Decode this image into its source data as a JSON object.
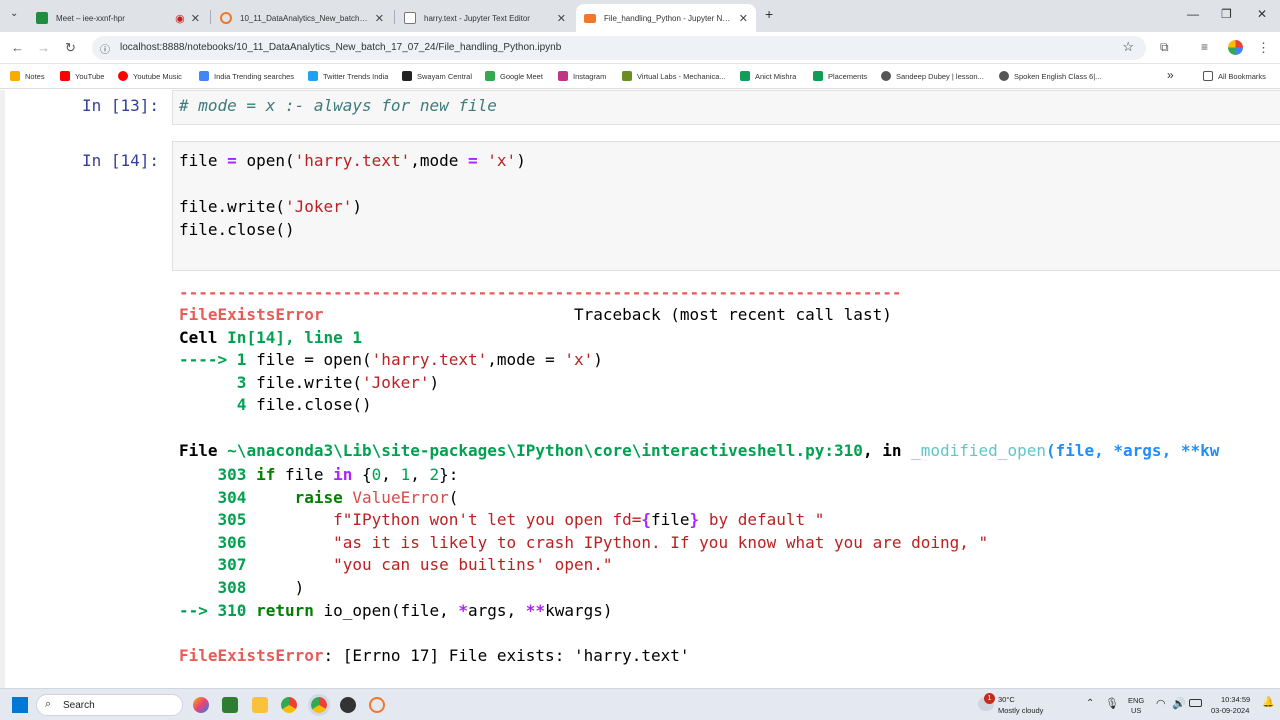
{
  "tabs": [
    {
      "title": "Meet – iee-xxnf-hpr",
      "fav": "#1a73e8"
    },
    {
      "title": "10_11_DataAnalytics_New_batch_17_0",
      "fav": "#f37726"
    },
    {
      "title": "harry.text - Jupyter Text Editor",
      "fav": "#f37726"
    },
    {
      "title": "File_handling_Python - Jupyter Notebo",
      "fav": "#f37726"
    }
  ],
  "url": "localhost:8888/notebooks/10_11_DataAnalytics_New_batch_17_07_24/File_handling_Python.ipynb",
  "bookmarks": [
    "Notes",
    "YouTube",
    "Youtube Music",
    "India Trending searches",
    "Twitter Trends India",
    "Swayam Central",
    "Google Meet",
    "Instagram",
    "Virtual Labs - Mechanica...",
    "Anict Mishra",
    "Placements",
    "Sandeep Dubey | lesson...",
    "Spoken English Class 6|..."
  ],
  "all_bookmarks": "All Bookmarks",
  "cells": {
    "c13": {
      "prompt": "In [13]:",
      "comment": "# mode = x :- always for new file"
    },
    "c14": {
      "prompt": "In [14]:",
      "l1": {
        "a": "file ",
        "op": "=",
        "b": " open(",
        "s1": "'harry.text'",
        "c": ",mode ",
        "op2": "=",
        "d": " ",
        "s2": "'x'",
        "e": ")"
      },
      "l2": {
        "a": "file.write(",
        "s": "'Joker'",
        "b": ")"
      },
      "l3": "file.close()"
    }
  },
  "traceback": {
    "dashes": "---------------------------------------------------------------------------",
    "err_name": "FileExistsError",
    "tb_head": "                          Traceback (most recent call last)",
    "cell_pre": "Cell ",
    "cell_ref": "In[14], line 1",
    "arrow1": "----> 1 ",
    "l1a": "file ",
    "l1op": "=",
    "l1b": " open(",
    "l1s": "'harry.text'",
    "l1c": ",mode ",
    "l1op2": "=",
    "l1d": " ",
    "l1s2": "'x'",
    "l1e": ")",
    "n3": "      3 ",
    "l3a": "file.write(",
    "l3s": "'Joker'",
    "l3b": ")",
    "n4": "      4 ",
    "l4": "file.close()",
    "file_pre": "File ",
    "file_path": "~\\anaconda3\\Lib\\site-packages\\IPython\\core\\interactiveshell.py:310",
    "file_in": ", in ",
    "file_fn": "_modified_open",
    "file_args": "(file, *args, **kw",
    "n303": "    303 ",
    "k_if": "if",
    "t303a": " file ",
    "k_in": "in",
    "t303b": " {",
    "v0": "0",
    ", ": ", ",
    "v1": "1",
    "v2": "2",
    "t303c": "}:",
    "n304": "    304 ",
    "t304a": "    ",
    "k_raise": "raise",
    "t304b": " ",
    "ve": "ValueError",
    "t304c": "(",
    "n305": "    305 ",
    "t305a": "        ",
    "s305a": "f\"IPython won't let you open fd=",
    "s305b": "{",
    "s305c": "file",
    "s305d": "}",
    "s305e": " by default \"",
    "n306": "    306 ",
    "t306a": "        ",
    "s306": "\"as it is likely to crash IPython. If you know what you are doing, \"",
    "n307": "    307 ",
    "t307a": "        ",
    "s307": "\"you can use builtins' open.\"",
    "n308": "    308 ",
    "t308": "    )",
    "arrow2": "--> 310 ",
    "k_return": "return",
    "t310": " io_open(file, ",
    "t310b": "*",
    "t310c": "args, ",
    "t310d": "**",
    "t310e": "kwargs)",
    "final_name": "FileExistsError",
    "final_msg": ": [Errno 17] File exists: 'harry.text'"
  },
  "taskbar": {
    "search": "Search",
    "weather_temp": "30°C",
    "weather_desc": "Mostly cloudy",
    "lang1": "ENG",
    "lang2": "US",
    "time": "10:34:59",
    "date": "03-09-2024",
    "badge": "1"
  }
}
